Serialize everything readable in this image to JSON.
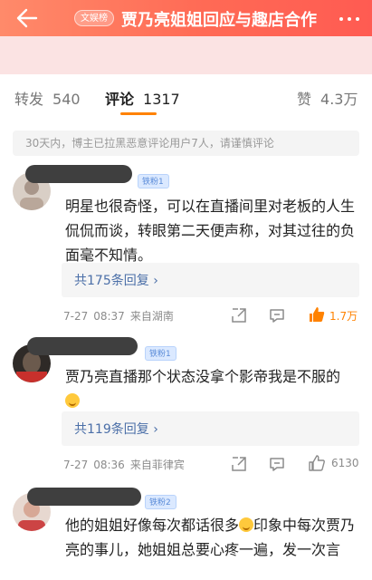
{
  "topbar": {
    "badge": "文娱榜",
    "title": "贾乃亮姐姐回应与趣店合作",
    "back_icon": "back-arrow-icon",
    "more_icon": "more-dots-icon",
    "background": "#ff6a55"
  },
  "tabs": [
    {
      "label": "转发",
      "count": "540"
    },
    {
      "label": "评论",
      "count": "1317",
      "active": true
    },
    {
      "label": "赞",
      "count": "4.3万"
    }
  ],
  "notice": "30天内，博主已拉黑恶意评论用户7人，请谨慎评论",
  "comments": [
    {
      "fan_badge": "铁粉1",
      "text": "明星也很奇怪，可以在直播间里对老板的人生侃侃而谈，转眼第二天便声称，对其过往的负面毫不知情。",
      "replies": "共175条回复",
      "date": "7-27",
      "time": "08:37",
      "location": "来自湖南",
      "likes": "1.7万",
      "liked": true
    },
    {
      "fan_badge": "铁粉1",
      "text": "贾乃亮直播那个状态没拿个影帝我是不服的",
      "replies": "共119条回复",
      "date": "7-27",
      "time": "08:36",
      "location": "来自菲律宾",
      "likes": "6130",
      "liked": false
    },
    {
      "fan_badge": "铁粉2",
      "text_a": "他的姐姐好像每次都话很多",
      "text_b": "印象中每次贾乃亮的事儿，她姐姐总要心疼一遍，发一次言"
    }
  ],
  "colors": {
    "accent": "#ff8200",
    "link": "#4b6fa8"
  }
}
